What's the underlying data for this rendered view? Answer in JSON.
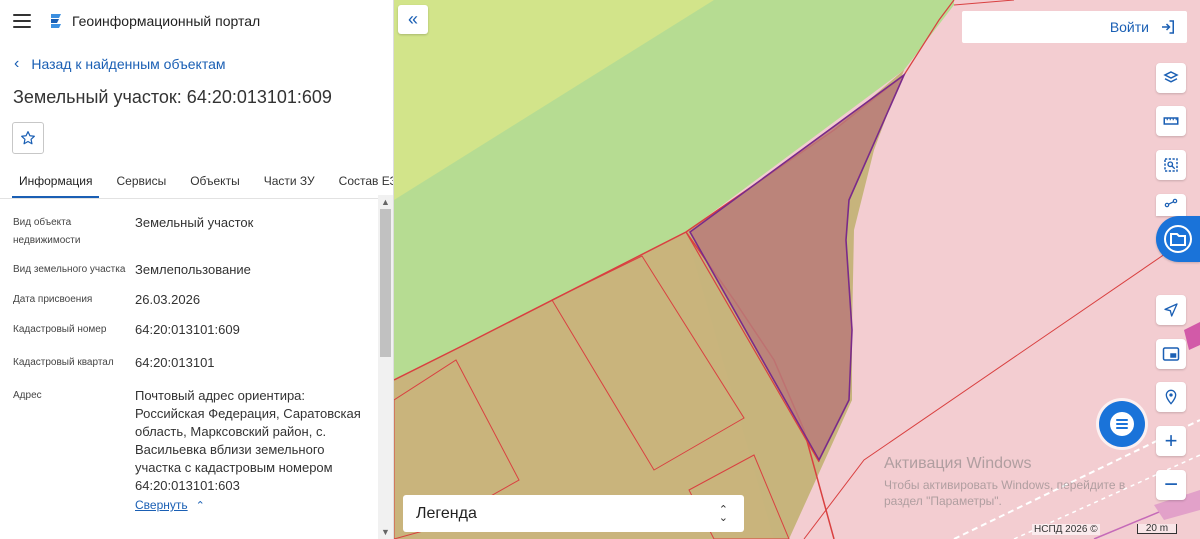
{
  "app": {
    "title": "Геоинформационный портал"
  },
  "nav": {
    "back_label": "Назад к найденным объектам"
  },
  "object": {
    "title": "Земельный участок: 64:20:013101:609"
  },
  "tabs": [
    {
      "label": "Информация",
      "active": true
    },
    {
      "label": "Сервисы"
    },
    {
      "label": "Объекты"
    },
    {
      "label": "Части ЗУ"
    },
    {
      "label": "Состав ЕЗП"
    }
  ],
  "info": {
    "rows": [
      {
        "label": "Вид объекта недвижимости",
        "value": "Земельный участок"
      },
      {
        "label": "Вид земельного участка",
        "value": "Землепользование"
      },
      {
        "label": "Дата присвоения",
        "value": "26.03.2026"
      },
      {
        "label": "Кадастровый номер",
        "value": "64:20:013101:609"
      },
      {
        "label": "Кадастровый квартал",
        "value": "64:20:013101"
      },
      {
        "label": "Адрес",
        "value": "Почтовый адрес ориентира: Российская Федерация, Саратовская область, Марксовский район, с. Васильевка вблизи земельного участка с кадастровым номером 64:20:013101:603"
      }
    ],
    "collapse_label": "Свернуть"
  },
  "map": {
    "login_label": "Войти",
    "legend_label": "Легенда",
    "watermark_title": "Активация Windows",
    "watermark_text": "Чтобы активировать Windows, перейдите в раздел \"Параметры\".",
    "copyright": "НСПД 2026 ©",
    "scale": "20 m"
  },
  "icons": {
    "tools": [
      "layers-icon",
      "ruler-icon",
      "select-area-icon",
      "share-icon",
      "folder-icon",
      "navigate-icon",
      "screen-icon",
      "pin-location-icon",
      "zoom-in-icon",
      "zoom-out-icon"
    ]
  },
  "colors": {
    "accent": "#1a5fb4",
    "parcel_line": "#d94040",
    "selected_parcel": "#7a2a8a"
  }
}
